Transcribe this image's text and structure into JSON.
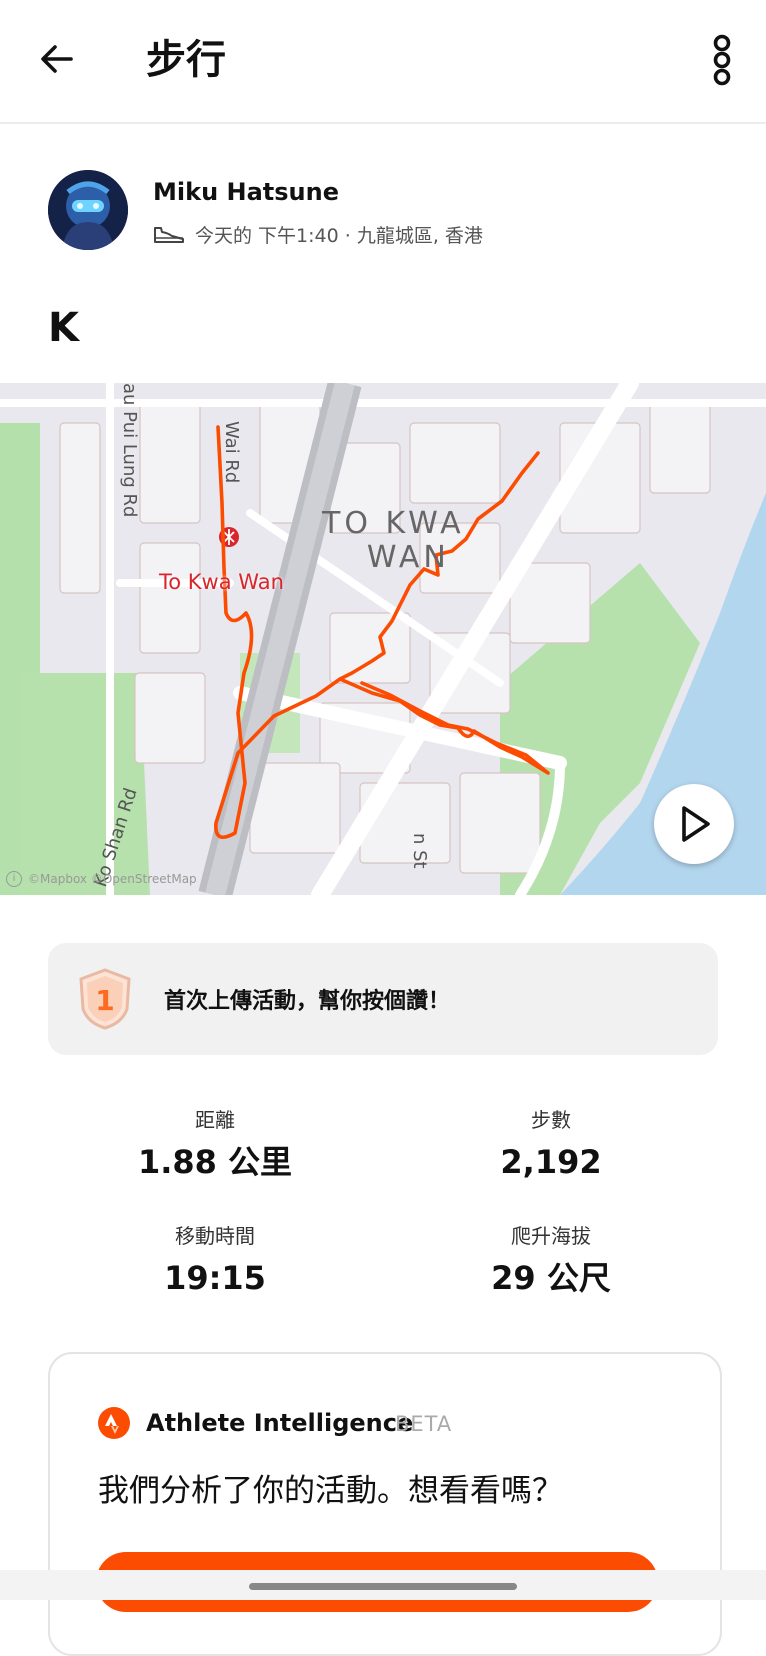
{
  "header": {
    "title": "步行"
  },
  "athlete": {
    "name": "Miku Hatsune",
    "meta": "今天的 下午1:40 · 九龍城區, 香港"
  },
  "activity": {
    "name": "K"
  },
  "map": {
    "labels": {
      "district_line1": "TO KWA",
      "district_line2": "WAN",
      "station": "To Kwa Wan",
      "road_wai": "Wai Rd",
      "road_pui_lung": "au Pui Lung Rd",
      "road_shan": "Ko Shan Rd",
      "road_st": "n St",
      "attribution": "©Mapbox ©OpenStreetMap"
    },
    "route_color": "#fc4c02"
  },
  "achievement": {
    "text": "首次上傳活動，幫你按個讚！",
    "badge_number": "1"
  },
  "stats": [
    {
      "label": "距離",
      "value": "1.88 公里"
    },
    {
      "label": "步數",
      "value": "2,192"
    },
    {
      "label": "移動時間",
      "value": "19:15"
    },
    {
      "label": "爬升海拔",
      "value": "29 公尺"
    }
  ],
  "athlete_intelligence": {
    "title": "Athlete Intelligence",
    "beta": "BETA",
    "text": "我們分析了你的活動。想看看嗎？"
  },
  "icons": {
    "back": "arrow-left-icon",
    "more": "more-vertical-icon",
    "shoe": "shoe-icon",
    "play": "play-icon",
    "badge": "first-upload-badge-icon",
    "ai": "strava-logo-icon"
  },
  "colors": {
    "accent": "#fc4c02",
    "park": "#a9dca4",
    "water": "#aed3ee"
  }
}
